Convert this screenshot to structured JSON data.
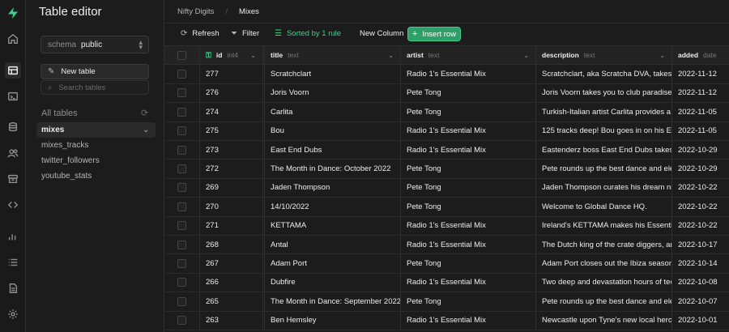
{
  "sidebar": {
    "title": "Table editor",
    "schema_label": "schema",
    "schema_value": "public",
    "new_table_label": "New table",
    "search_placeholder": "Search tables",
    "all_tables_label": "All tables",
    "tables": [
      "mixes",
      "mixes_tracks",
      "twitter_followers",
      "youtube_stats"
    ],
    "active_table": "mixes"
  },
  "breadcrumb": {
    "project": "Nifty Digits",
    "table": "Mixes"
  },
  "toolbar": {
    "refresh": "Refresh",
    "filter": "Filter",
    "sorted": "Sorted by 1 rule",
    "new_column": "New Column",
    "insert_row": "Insert row"
  },
  "columns": [
    {
      "name": "id",
      "type": "int4"
    },
    {
      "name": "title",
      "type": "text"
    },
    {
      "name": "artist",
      "type": "text"
    },
    {
      "name": "description",
      "type": "text"
    },
    {
      "name": "added",
      "type": "date"
    }
  ],
  "rows": [
    {
      "id": "277",
      "title": "Scratchclart",
      "artist": "Radio 1's Essential Mix",
      "description": "Scratchclart, aka Scratcha DVA, takes over",
      "added": "2022-11-12"
    },
    {
      "id": "276",
      "title": "Joris Voorn",
      "artist": "Pete Tong",
      "description": "Joris Voorn takes you to club paradise.",
      "added": "2022-11-12"
    },
    {
      "id": "274",
      "title": "Carlita",
      "artist": "Pete Tong",
      "description": "Turkish-Italian artist Carlita provides a 'Su",
      "added": "2022-11-05"
    },
    {
      "id": "275",
      "title": "Bou",
      "artist": "Radio 1's Essential Mix",
      "description": "125 tracks deep! Bou goes in on his Essent",
      "added": "2022-11-05"
    },
    {
      "id": "273",
      "title": "East End Dubs",
      "artist": "Radio 1's Essential Mix",
      "description": "Eastenderz boss East End Dubs takes over",
      "added": "2022-10-29"
    },
    {
      "id": "272",
      "title": "The Month in Dance: October 2022",
      "artist": "Pete Tong",
      "description": "Pete rounds up the best dance and electro",
      "added": "2022-10-29"
    },
    {
      "id": "269",
      "title": "Jaden Thompson",
      "artist": "Pete Tong",
      "description": "Jaden Thompson curates his dream night",
      "added": "2022-10-22"
    },
    {
      "id": "270",
      "title": "14/10/2022",
      "artist": "Pete Tong",
      "description": "Welcome to Global Dance HQ.",
      "added": "2022-10-22"
    },
    {
      "id": "271",
      "title": "KETTAMA",
      "artist": "Radio 1's Essential Mix",
      "description": "Ireland's KETTAMA makes his Essential Mi",
      "added": "2022-10-22"
    },
    {
      "id": "268",
      "title": "Antal",
      "artist": "Radio 1's Essential Mix",
      "description": "The Dutch king of the crate diggers, and I",
      "added": "2022-10-17"
    },
    {
      "id": "267",
      "title": "Adam Port",
      "artist": "Pete Tong",
      "description": "Adam Port closes out the Ibiza season wit",
      "added": "2022-10-14"
    },
    {
      "id": "266",
      "title": "Dubfire",
      "artist": "Radio 1's Essential Mix",
      "description": "Two deep and devastation hours of techn",
      "added": "2022-10-08"
    },
    {
      "id": "265",
      "title": "The Month in Dance: September 2022",
      "artist": "Pete Tong",
      "description": "Pete rounds up the best dance and electro",
      "added": "2022-10-07"
    },
    {
      "id": "263",
      "title": "Ben Hemsley",
      "artist": "Radio 1's Essential Mix",
      "description": "Newcastle upon Tyne's new local hero Be",
      "added": "2022-10-01"
    }
  ],
  "colors": {
    "accent": "#3ecf8e",
    "background": "#1c1c1c",
    "border": "#2e2e2e"
  }
}
